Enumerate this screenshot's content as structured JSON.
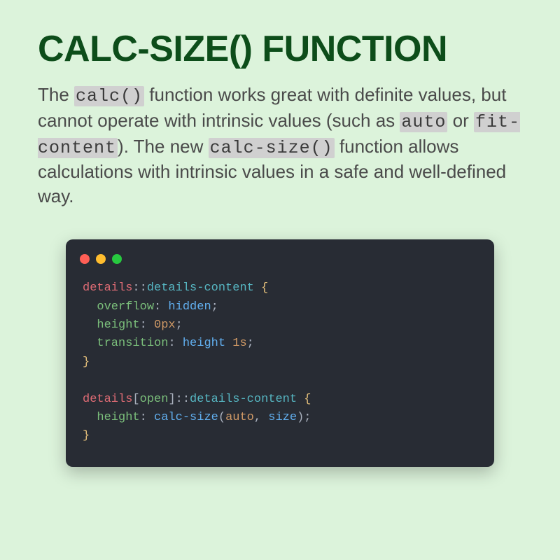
{
  "title": "calc-size() function",
  "description": {
    "pre1": "The ",
    "code1": "calc()",
    "mid1": " function works great with definite values, but cannot operate with intrinsic values (such as ",
    "code2": "auto",
    "mid2": " or ",
    "code3": "fit-content",
    "mid3": "). The new ",
    "code4": "calc-size()",
    "post": " function allows calculations with intrinsic values in a safe and well-defined way."
  },
  "code": {
    "line1": {
      "sel": "details",
      "colon": "::",
      "pseudo": "details-content",
      "brace": " {"
    },
    "line2": {
      "prop": "overflow",
      "colon": ":",
      "val": " hidden",
      "semi": ";"
    },
    "line3": {
      "prop": "height",
      "colon": ":",
      "val": " 0px",
      "semi": ";"
    },
    "line4": {
      "prop": "transition",
      "colon": ":",
      "val_kw": " height",
      "val_num": " 1s",
      "semi": ";"
    },
    "line5": {
      "brace": "}"
    },
    "line7": {
      "sel": "details",
      "lb": "[",
      "attr": "open",
      "rb": "]",
      "colon": "::",
      "pseudo": "details-content",
      "brace": " {"
    },
    "line8": {
      "prop": "height",
      "colon": ":",
      "func": " calc-size",
      "lp": "(",
      "arg1": "auto",
      "comma": ",",
      "arg2": " size",
      "rp": ")",
      "semi": ";"
    },
    "line9": {
      "brace": "}"
    }
  },
  "dots": {
    "red": "#ff5f56",
    "yellow": "#ffbd2e",
    "green": "#27c93f"
  }
}
